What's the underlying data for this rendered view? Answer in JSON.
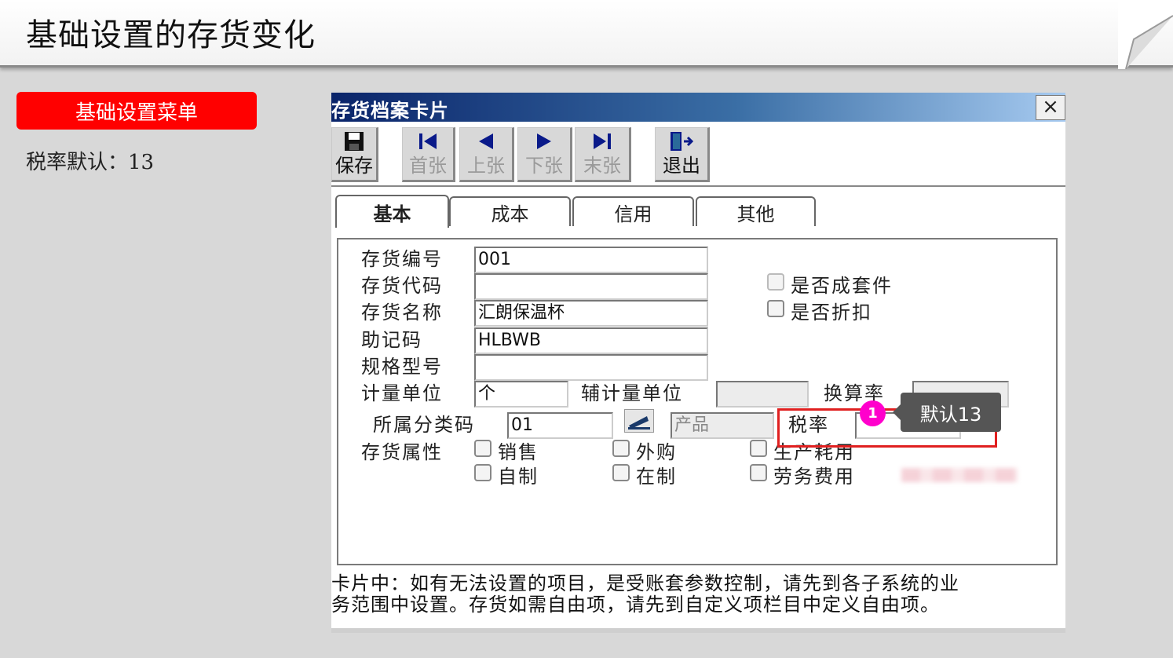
{
  "slide": {
    "title": "基础设置的存货变化",
    "menu_badge": "基础设置菜单",
    "note": "税率默认：13"
  },
  "dialog": {
    "title": "存货档案卡片",
    "close_label": "×",
    "toolbar": {
      "save": "保存",
      "first": "首张",
      "prev": "上张",
      "next": "下张",
      "last": "末张",
      "exit": "退出"
    },
    "tabs": [
      "基本",
      "成本",
      "信用",
      "其他"
    ],
    "fields": {
      "code_label": "存货编号",
      "code_value": "001",
      "alias_label": "存货代码",
      "alias_value": "",
      "name_label": "存货名称",
      "name_value": "汇朗保温杯",
      "mnemonic_label": "助记码",
      "mnemonic_value": "HLBWB",
      "spec_label": "规格型号",
      "spec_value": "",
      "unit_label": "计量单位",
      "unit_value": "个",
      "aux_unit_label": "辅计量单位",
      "aux_unit_value": "",
      "rate_label": "换算率",
      "rate_value": "",
      "category_label": "所属分类码",
      "category_value": "01",
      "category_name": "产品",
      "tax_label": "税率",
      "tax_value": "",
      "attr_label": "存货属性"
    },
    "checkboxes": {
      "kit": "是否成套件",
      "discount": "是否折扣",
      "sales": "销售",
      "purchase": "外购",
      "production": "生产耗用",
      "self_made": "自制",
      "in_process": "在制",
      "service": "劳务费用"
    },
    "callout": {
      "step": "1",
      "text": "默认13"
    },
    "footnote": [
      "卡片中：如有无法设置的项目，是受账套参数控制，请先到各子系统的业",
      "务范围中设置。存货如需自由项，请先到自定义项栏目中定义自由项。"
    ]
  },
  "colors": {
    "titlebar_start": "#0a246a",
    "titlebar_end": "#a6caf0",
    "menu_badge": "#ff0000",
    "highlight": "#e02020",
    "step_dot": "#ff00cc"
  }
}
